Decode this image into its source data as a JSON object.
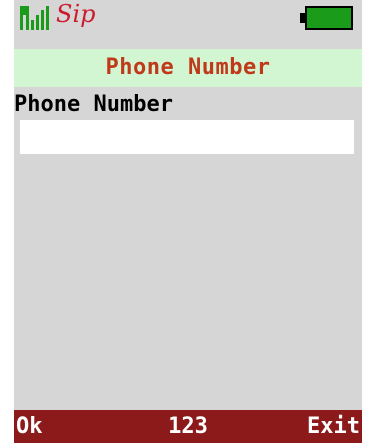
{
  "status": {
    "signal_icon": "signal-bars-icon",
    "logo_text": "Sip",
    "battery_icon": "battery-full-icon",
    "battery_color": "#1a9c1a"
  },
  "screen": {
    "title": "Phone Number",
    "field_label": "Phone Number",
    "field_value": "",
    "title_color": "#c0391b",
    "title_bg": "#d2f5d2"
  },
  "softkeys": {
    "left": "Ok",
    "center": "123",
    "right": "Exit",
    "bar_color": "#8c1a1a"
  }
}
